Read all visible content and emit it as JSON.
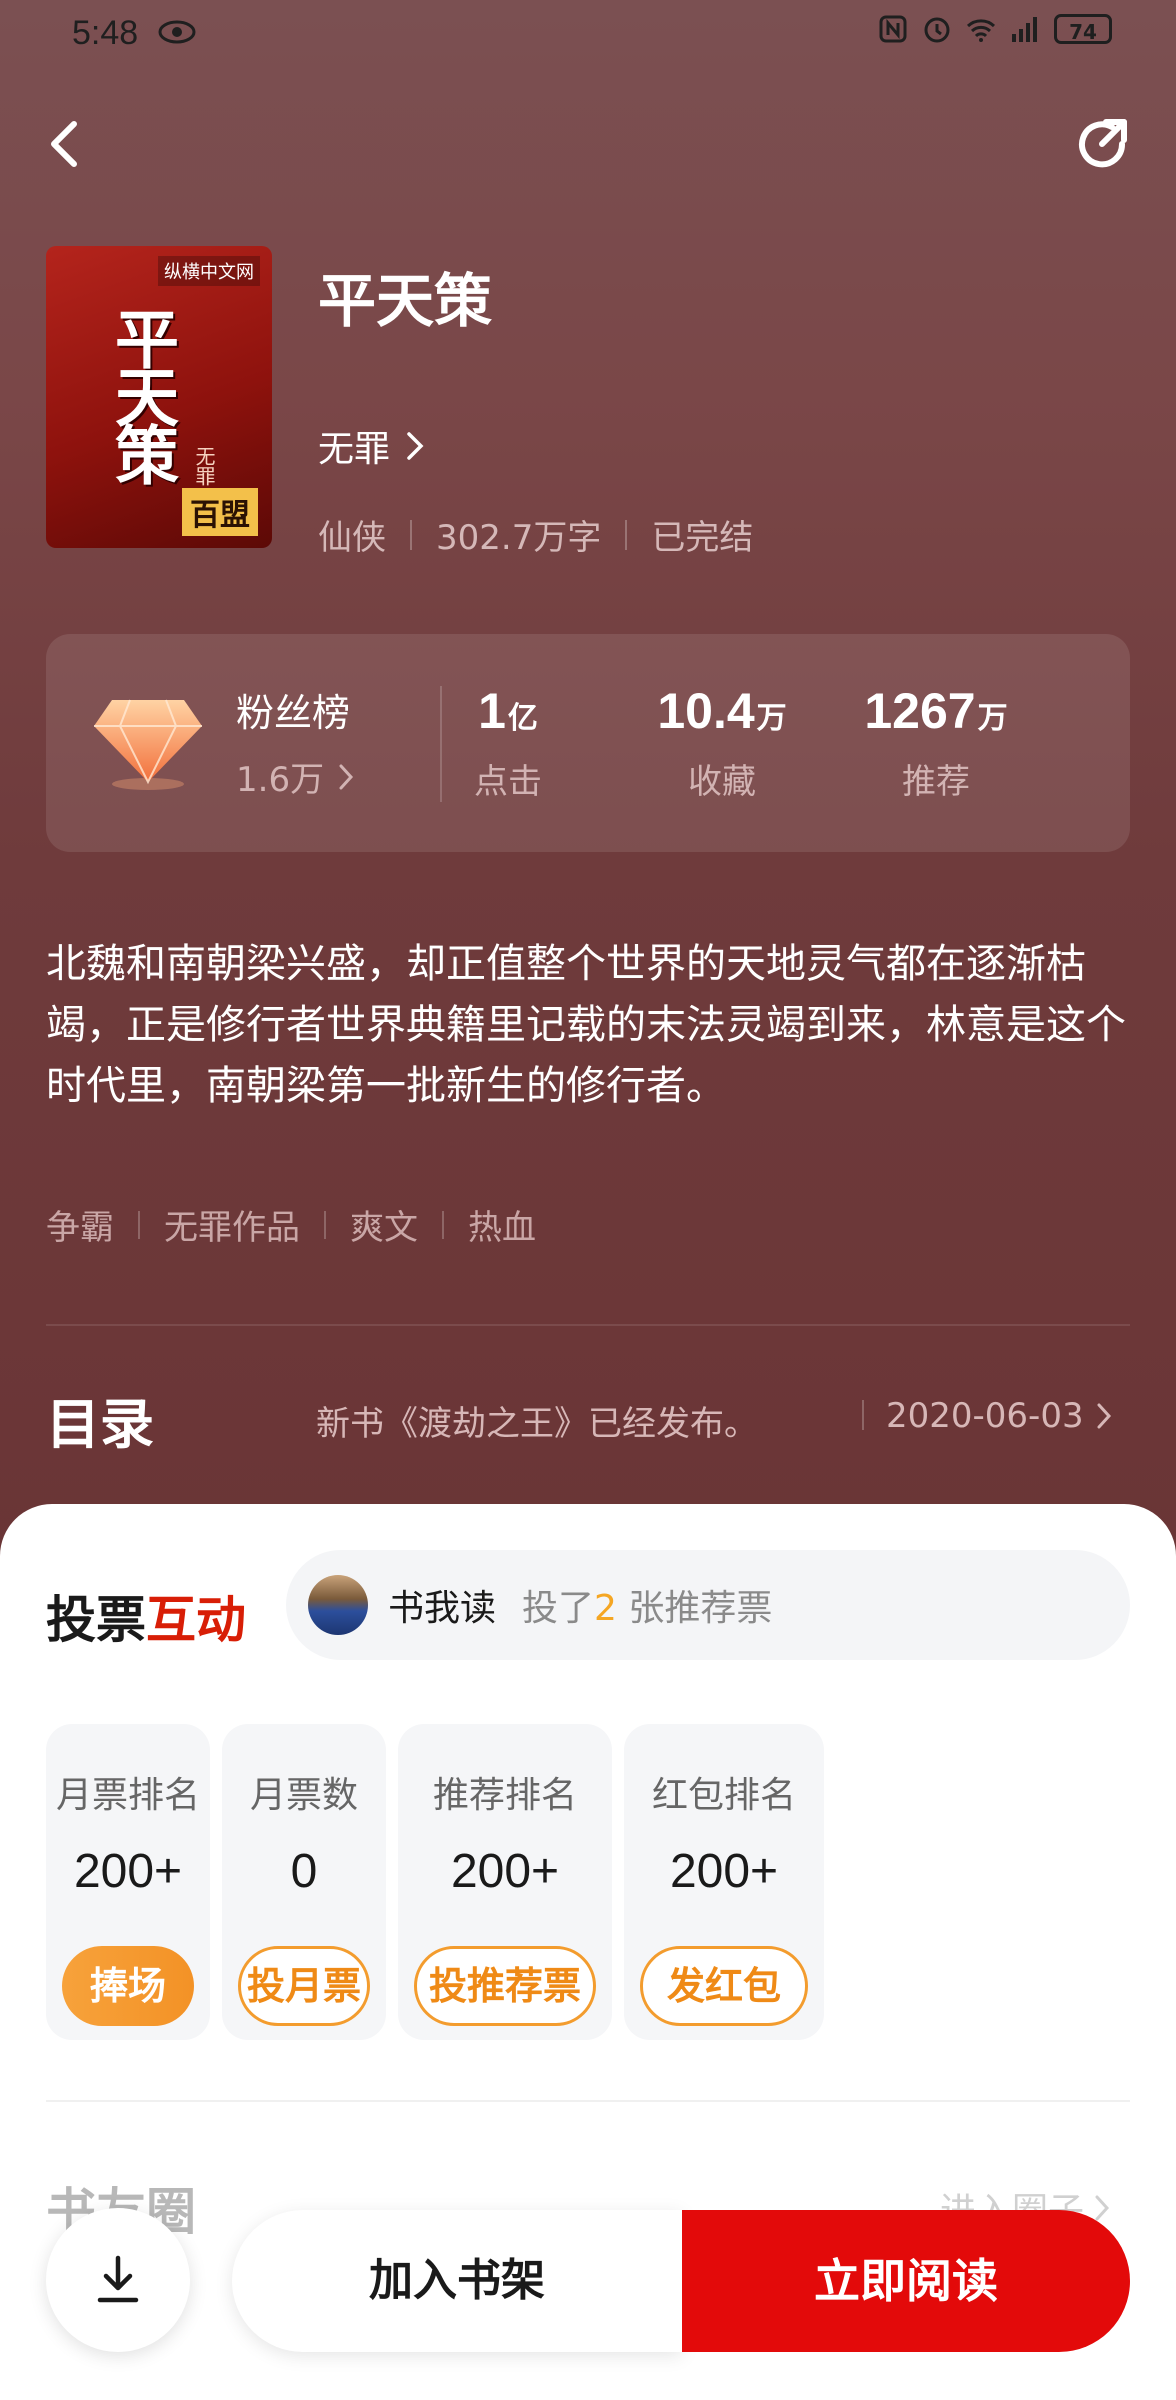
{
  "status_bar": {
    "time": "5:48",
    "battery": "74",
    "icons": [
      "eye-icon",
      "nfc-icon",
      "alarm-icon",
      "wifi-icon",
      "signal-4g-icon",
      "battery-icon"
    ]
  },
  "nav": {
    "back_icon": "chevron-left-icon",
    "share_icon": "share-icon"
  },
  "book": {
    "cover": {
      "logo": "纵横中文网",
      "title": "平天策",
      "author": "无罪",
      "badge": "百盟"
    },
    "title": "平天策",
    "author": "无罪",
    "genre": "仙侠",
    "word_count": "302.7万字",
    "status": "已完结"
  },
  "stats": {
    "fan_rank_label": "粉丝榜",
    "fan_count": "1.6万",
    "items": [
      {
        "value": "1",
        "unit": "亿",
        "label": "点击"
      },
      {
        "value": "10.4",
        "unit": "万",
        "label": "收藏"
      },
      {
        "value": "1267",
        "unit": "万",
        "label": "推荐"
      }
    ]
  },
  "synopsis": "北魏和南朝梁兴盛，却正值整个世界的天地灵气都在逐渐枯竭，正是修行者世界典籍里记载的末法灵竭到来，林意是这个时代里，南朝梁第一批新生的修行者。",
  "tags": [
    "争霸",
    "无罪作品",
    "爽文",
    "热血"
  ],
  "toc": {
    "title": "目录",
    "latest": "新书《渡劫之王》已经发布。",
    "date": "2020-06-03"
  },
  "vote": {
    "heading_a": "投票",
    "heading_b": "互动",
    "feed": {
      "user": "书我读",
      "text_pre": "投了",
      "count": "2",
      "text_post": "张推荐票"
    },
    "cards": [
      {
        "label": "月票排名",
        "value": "200+",
        "button": "捧场"
      },
      {
        "label": "月票数",
        "value": "0",
        "button": "投月票"
      },
      {
        "label": "推荐排名",
        "value": "200+",
        "button": "投推荐票"
      },
      {
        "label": "红包排名",
        "value": "200+",
        "button": "发红包"
      }
    ]
  },
  "circle": {
    "title": "书友圈",
    "link": "进入圈子"
  },
  "actions": {
    "shelf": "加入书架",
    "read": "立即阅读"
  },
  "colors": {
    "accent_red": "#e30a0a",
    "accent_orange": "#f39226",
    "hero_bg": "#6f3b3c"
  }
}
